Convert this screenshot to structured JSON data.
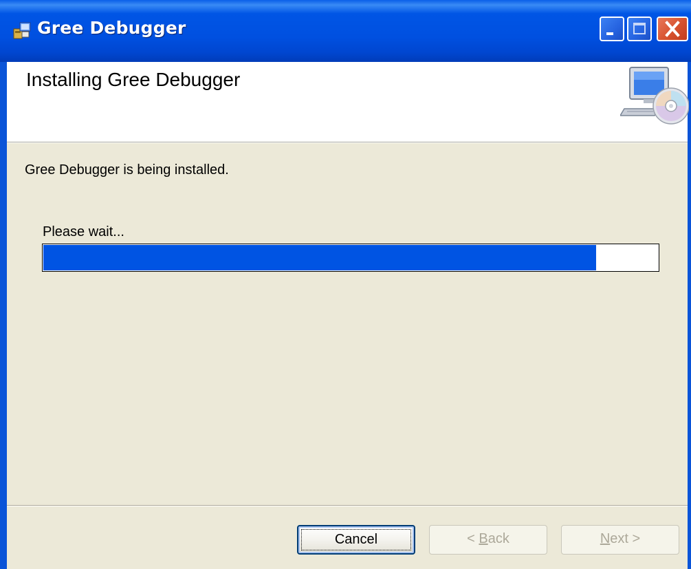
{
  "window": {
    "title": "Gree Debugger",
    "colors": {
      "titlebar": "#0055e5",
      "face": "#ece9d8",
      "close": "#d7522f"
    }
  },
  "banner": {
    "heading": "Installing Gree Debugger",
    "icon": "computer-cd-icon"
  },
  "body": {
    "status": "Gree Debugger is being installed.",
    "wait_label": "Please wait...",
    "progress_fraction": 0.9,
    "progress_color": "#0054e3"
  },
  "buttons": {
    "cancel": "Cancel",
    "back_prefix": "< ",
    "back_accel": "B",
    "back_rest": "ack",
    "next_accel": "N",
    "next_rest": "ext >"
  }
}
